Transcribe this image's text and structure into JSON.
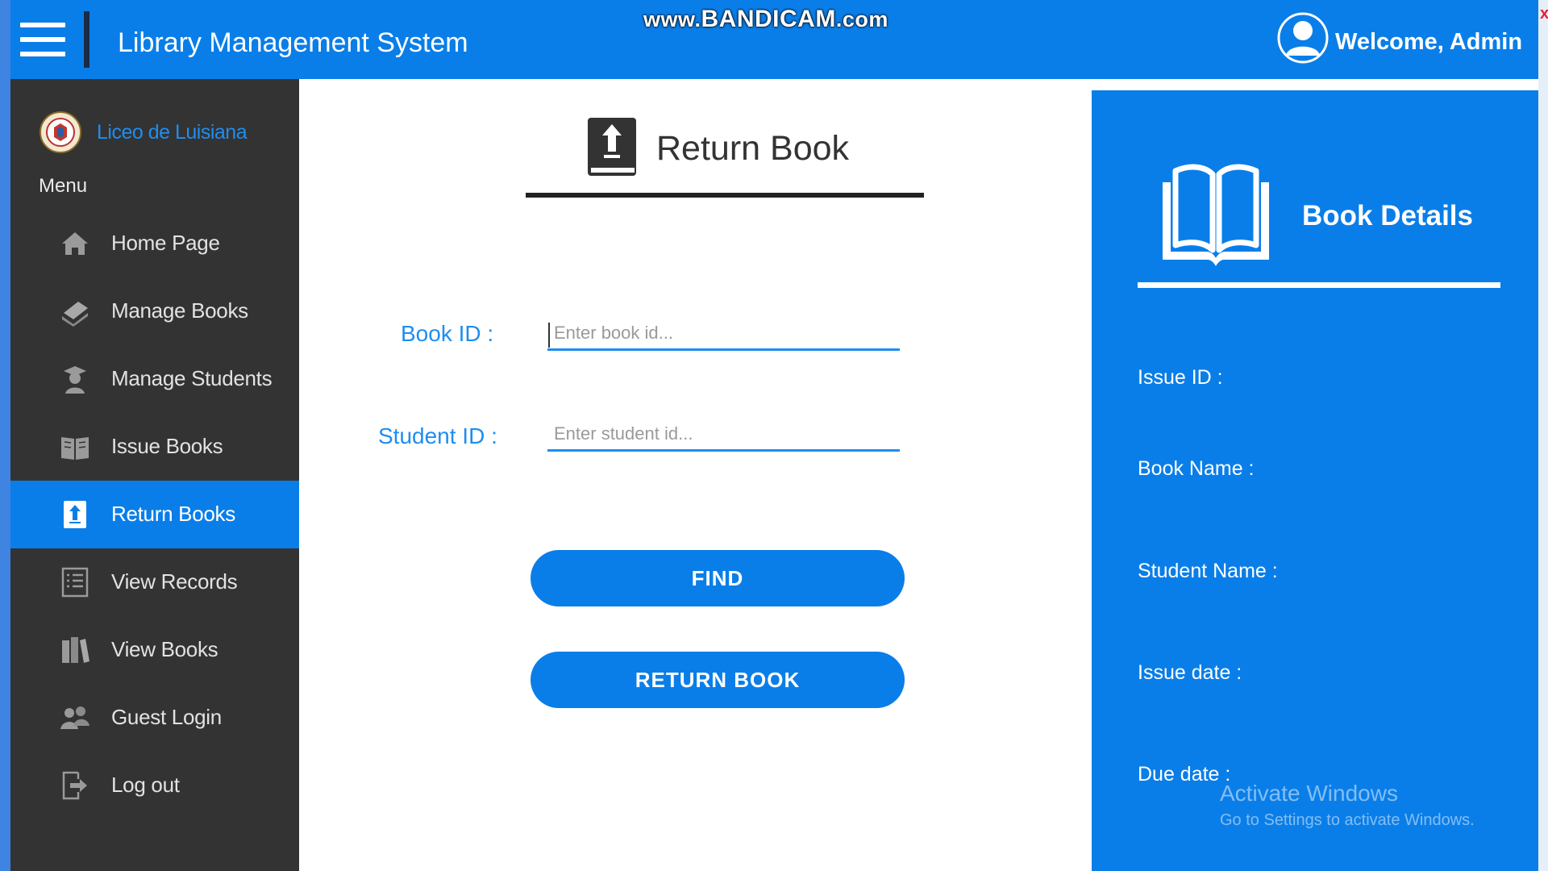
{
  "header": {
    "app_title": "Library Management System",
    "recorder_watermark_prefix": "www.",
    "recorder_watermark_brand": "BANDICAM",
    "recorder_watermark_suffix": ".com",
    "welcome_text": "Welcome, Admin",
    "close_glyph": "x"
  },
  "sidebar": {
    "school_name": "Liceo de Luisiana",
    "menu_heading": "Menu",
    "items": [
      {
        "label": "Home Page",
        "icon": "home-icon"
      },
      {
        "label": "Manage Books",
        "icon": "book-stack-icon"
      },
      {
        "label": "Manage Students",
        "icon": "student-icon"
      },
      {
        "label": "Issue Books",
        "icon": "open-book-icon"
      },
      {
        "label": "Return Books",
        "icon": "return-book-icon",
        "active": true
      },
      {
        "label": "View Records",
        "icon": "list-icon"
      },
      {
        "label": "View Books",
        "icon": "books-icon"
      },
      {
        "label": "Guest Login",
        "icon": "users-icon"
      },
      {
        "label": "Log out",
        "icon": "logout-icon"
      }
    ]
  },
  "main": {
    "title": "Return Book",
    "book_id": {
      "label": "Book ID :",
      "value": "",
      "placeholder": "Enter book id..."
    },
    "student_id": {
      "label": "Student ID :",
      "value": "",
      "placeholder": "Enter student id..."
    },
    "find_button": "FIND",
    "return_button": "RETURN BOOK"
  },
  "details": {
    "title": "Book Details",
    "fields": [
      "Issue ID :",
      "Book Name :",
      "Student Name :",
      "Issue date :",
      "Due date :"
    ]
  },
  "os_watermark": {
    "line1": "Activate Windows",
    "line2": "Go to Settings to activate Windows."
  },
  "colors": {
    "accent": "#0a7ee8",
    "sidebar_bg": "#333333",
    "label_blue": "#1e8ef0"
  }
}
